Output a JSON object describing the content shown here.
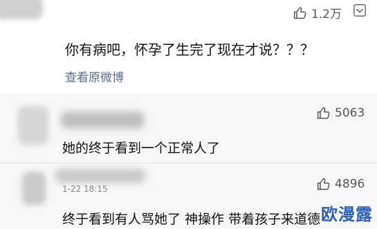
{
  "comment1": {
    "likes": "1.2万",
    "text": "你有病吧，怀孕了生完了现在才说？？？",
    "link": "查看原微博"
  },
  "reply1": {
    "likes": "5063",
    "text": "她的终于看到一个正常人了"
  },
  "reply2": {
    "time": "1-22 18:15",
    "likes": "4896",
    "text": "终于看到有人骂她了 神操作 带着孩子来道德"
  },
  "watermark": "欧漫露",
  "icons": {
    "like": "thumbs-up-icon",
    "more": "more-icon"
  }
}
